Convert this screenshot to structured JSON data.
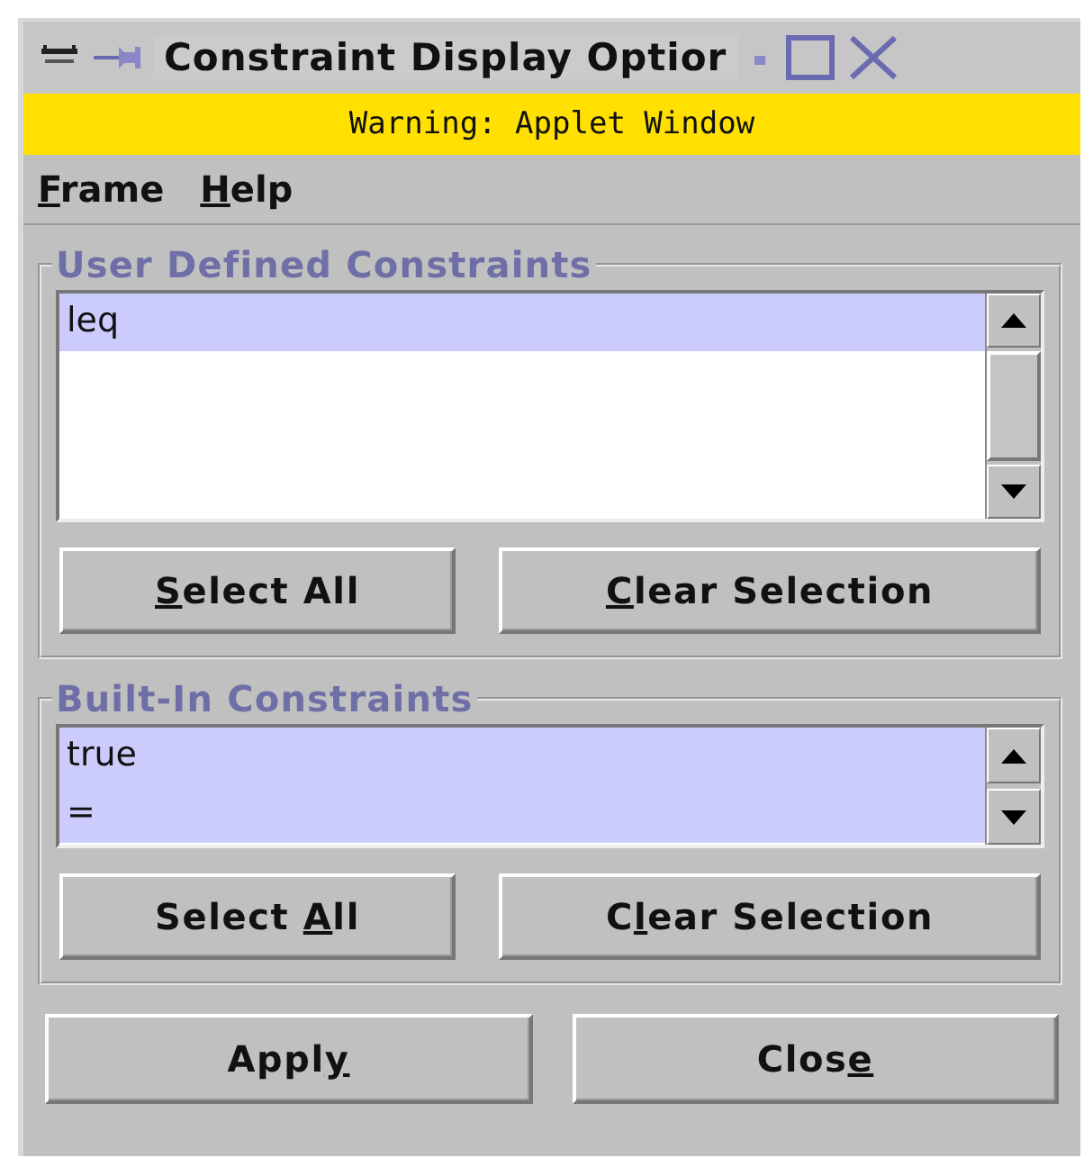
{
  "window": {
    "title": "Constraint Display Optior"
  },
  "warning": "Warning: Applet Window",
  "menu": [
    {
      "key": "F",
      "after": "rame"
    },
    {
      "key": "H",
      "after": "elp"
    }
  ],
  "groups": [
    {
      "title": "User Defined Constraints",
      "items": [
        {
          "label": "leq",
          "selected": true
        }
      ],
      "scroll_thumb": true,
      "buttons": [
        {
          "key": "S",
          "after": "elect All"
        },
        {
          "key": "C",
          "after": "lear Selection"
        }
      ]
    },
    {
      "title": "Built-In Constraints",
      "items": [
        {
          "label": "true",
          "selected": true
        },
        {
          "label": "=",
          "selected": true
        }
      ],
      "scroll_thumb": false,
      "buttons": [
        {
          "before": "Select ",
          "key": "A",
          "after": "ll"
        },
        {
          "before": "C",
          "key": "l",
          "after": "ear Selection"
        }
      ]
    }
  ],
  "buttons": [
    {
      "before": "Appl",
      "key": "y"
    },
    {
      "before": "Clos",
      "key": "e"
    }
  ]
}
